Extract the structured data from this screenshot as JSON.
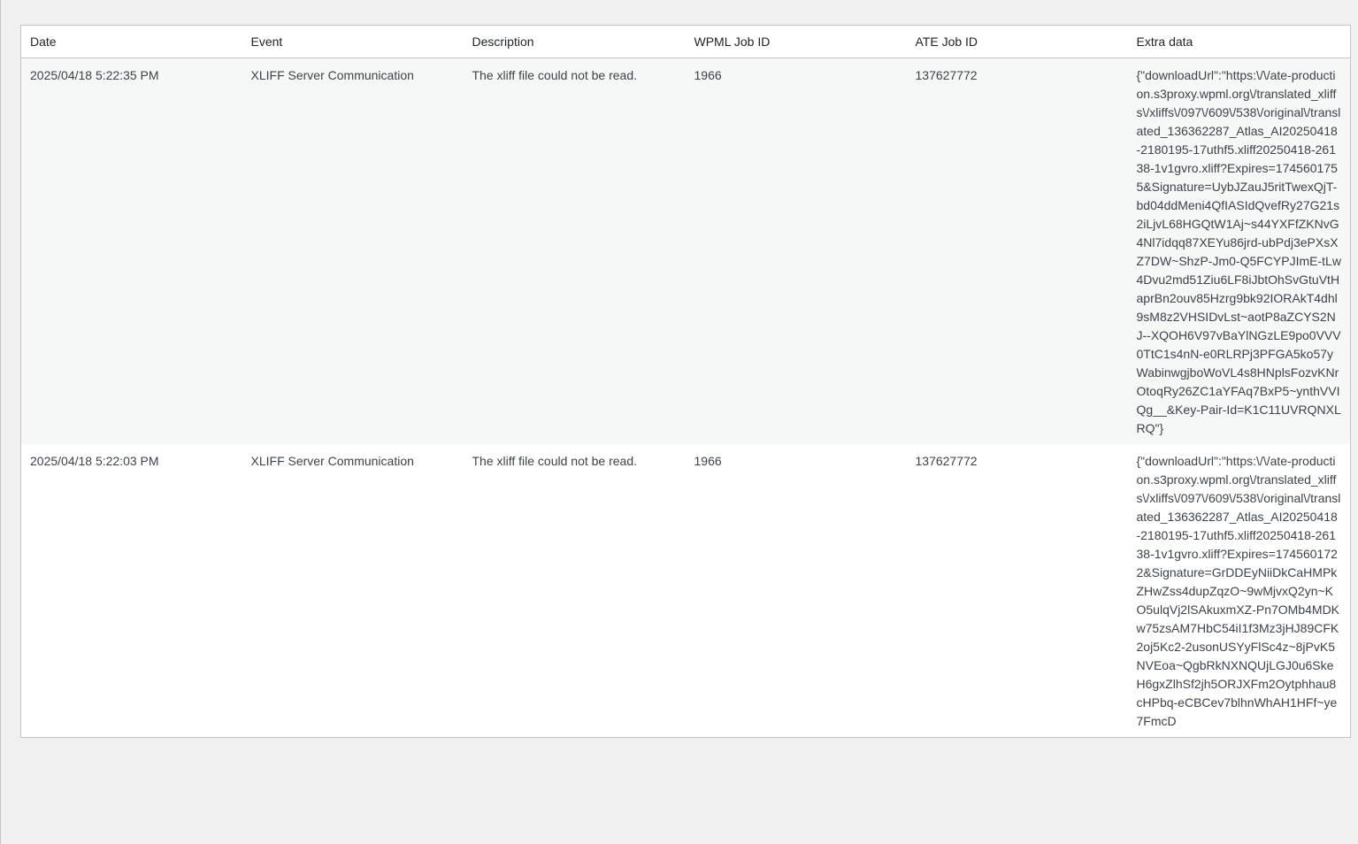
{
  "table": {
    "headers": [
      "Date",
      "Event",
      "Description",
      "WPML Job ID",
      "ATE Job ID",
      "Extra data"
    ],
    "rows": [
      {
        "date": "2025/04/18 5:22:35 PM",
        "event": "XLIFF Server Communication",
        "description": "The xliff file could not be read.",
        "wpml_job_id": "1966",
        "ate_job_id": "137627772",
        "extra_data": "{\"downloadUrl\":\"https:\\/\\/ate-production.s3proxy.wpml.org\\/translated_xliffs\\/xliffs\\/097\\/609\\/538\\/original\\/translated_136362287_Atlas_AI20250418-2180195-17uthf5.xliff20250418-26138-1v1gvro.xliff?Expires=1745601755&Signature=UybJZauJ5ritTwexQjT-bd04ddMeni4QfIASIdQvefRy27G21s2iLjvL68HGQtW1Aj~s44YXFfZKNvG4Nl7idqq87XEYu86jrd-ubPdj3ePXsXZ7DW~ShzP-Jm0-Q5FCYPJImE-tLw4Dvu2md51Ziu6LF8iJbtOhSvGtuVtHaprBn2ouv85Hzrg9bk92IORAkT4dhl9sM8z2VHSIDvLst~aotP8aZCYS2NJ--XQOH6V97vBaYlNGzLE9po0VVV0TtC1s4nN-e0RLRPj3PFGA5ko57yWabinwgjboWoVL4s8HNplsFozvKNrOtoqRy26ZC1aYFAq7BxP5~ynthVVIQg__&Key-Pair-Id=K1C11UVRQNXLRQ\"}"
      },
      {
        "date": "2025/04/18 5:22:03 PM",
        "event": "XLIFF Server Communication",
        "description": "The xliff file could not be read.",
        "wpml_job_id": "1966",
        "ate_job_id": "137627772",
        "extra_data": "{\"downloadUrl\":\"https:\\/\\/ate-production.s3proxy.wpml.org\\/translated_xliffs\\/xliffs\\/097\\/609\\/538\\/original\\/translated_136362287_Atlas_AI20250418-2180195-17uthf5.xliff20250418-26138-1v1gvro.xliff?Expires=1745601722&Signature=GrDDEyNiiDkCaHMPkZHwZss4dupZqzO~9wMjvxQ2yn~KO5ulqVj2lSAkuxmXZ-Pn7OMb4MDKw75zsAM7HbC54iI1f3Mz3jHJ89CFK2oj5Kc2-2usonUSYyFlSc4z~8jPvK5NVEoa~QgbRkNXNQUjLGJ0u6SkeH6gxZlhSf2jh5ORJXFm2Oytphhau8cHPbq-eCBCev7blhnWhAH1HFf~ye7FmcD"
      }
    ]
  }
}
